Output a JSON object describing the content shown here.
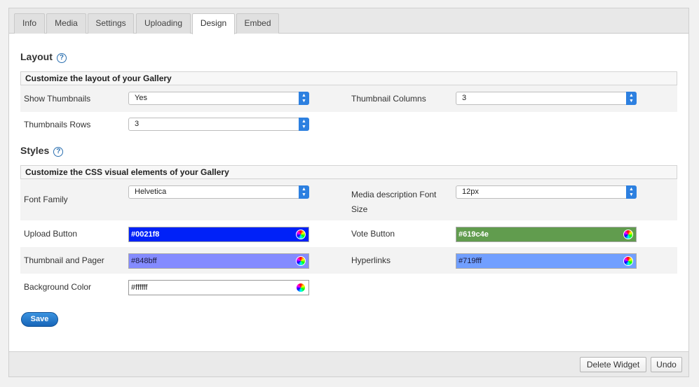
{
  "tabs": [
    "Info",
    "Media",
    "Settings",
    "Uploading",
    "Design",
    "Embed"
  ],
  "active_tab": "Design",
  "layout": {
    "title": "Layout",
    "help": "?",
    "subheading": "Customize the layout of your Gallery",
    "show_thumbnails": {
      "label": "Show Thumbnails",
      "value": "Yes"
    },
    "thumbnail_columns": {
      "label": "Thumbnail Columns",
      "value": "3"
    },
    "thumbnails_rows": {
      "label": "Thumbnails Rows",
      "value": "3"
    }
  },
  "styles": {
    "title": "Styles",
    "help": "?",
    "subheading": "Customize the CSS visual elements of your Gallery",
    "font_family": {
      "label": "Font Family",
      "value": "Helvetica"
    },
    "media_font_size": {
      "label_line1": "Media description Font",
      "label_line2": "Size",
      "value": "12px"
    },
    "upload_button": {
      "label": "Upload Button",
      "value": "#0021f8",
      "color": "#0021f8"
    },
    "vote_button": {
      "label": "Vote Button",
      "value": "#619c4e",
      "color": "#619c4e"
    },
    "thumbnail_pager": {
      "label": "Thumbnail and Pager",
      "value": "#848bff",
      "color": "#848bff"
    },
    "hyperlinks": {
      "label": "Hyperlinks",
      "value": "#719fff",
      "color": "#719fff"
    },
    "background_color": {
      "label": "Background Color",
      "value": "#ffffff",
      "color": "#ffffff"
    }
  },
  "save_label": "Save",
  "footer": {
    "delete_label": "Delete Widget",
    "undo_label": "Undo"
  }
}
